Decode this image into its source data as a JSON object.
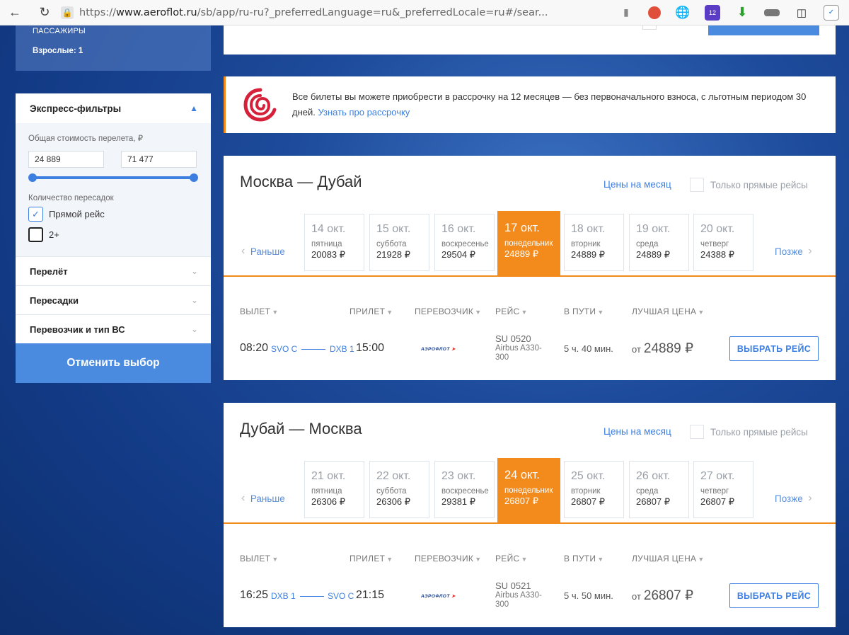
{
  "browser": {
    "url_prefix": "https://",
    "url_domain": "www.aeroflot.ru",
    "url_path": "/sb/app/ru-ru?_preferredLanguage=ru&_preferredLocale=ru#/sear...",
    "ext_badge": "12"
  },
  "sidebar": {
    "passengers_title": "ПАССАЖИРЫ",
    "passengers_value": "Взрослые: 1",
    "express_title": "Экспресс-фильтры",
    "price_label": "Общая стоимость перелета, ₽",
    "price_min": "24 889",
    "price_max": "71 477",
    "price_range_fraction": [
      0,
      1
    ],
    "transfers_label": "Количество пересадок",
    "opt_direct": "Прямой рейс",
    "opt_two_plus": "2+",
    "sec_flight": "Перелёт",
    "sec_transfers": "Пересадки",
    "sec_carrier": "Перевозчик и тип ВС",
    "cancel": "Отменить выбор"
  },
  "promo": {
    "text": "Все билеты вы можете приобрести в рассрочку на 12 месяцев — без первоначального взноса, с льготным периодом 30 дней.",
    "link": "Узнать про рассрочку"
  },
  "common": {
    "month_prices": "Цены на месяц",
    "direct_only": "Только прямые рейсы",
    "earlier": "Раньше",
    "later": "Позже",
    "col_departure": "ВЫЛЕТ",
    "col_arrival": "ПРИЛЕТ",
    "col_carrier": "ПЕРЕВОЗЧИК",
    "col_flight": "РЕЙС",
    "col_duration": "В ПУТИ",
    "col_best_price": "ЛУЧШАЯ ЦЕНА",
    "select": "ВЫБРАТЬ РЕЙС",
    "from": "от",
    "carrier_logo": "АЭРОФЛОТ"
  },
  "outbound": {
    "title": "Москва — Дубай",
    "dates": [
      {
        "d": "14 окт.",
        "w": "пятница",
        "p": "20083 ₽"
      },
      {
        "d": "15 окт.",
        "w": "суббота",
        "p": "21928 ₽"
      },
      {
        "d": "16 окт.",
        "w": "воскресенье",
        "p": "29504 ₽"
      },
      {
        "d": "17 окт.",
        "w": "понедельник",
        "p": "24889 ₽"
      },
      {
        "d": "18 окт.",
        "w": "вторник",
        "p": "24889 ₽"
      },
      {
        "d": "19 окт.",
        "w": "среда",
        "p": "24889 ₽"
      },
      {
        "d": "20 окт.",
        "w": "четверг",
        "p": "24388 ₽"
      }
    ],
    "flight": {
      "dep_time": "08:20",
      "dep_airport": "SVO C",
      "arr_airport": "DXB 1",
      "arr_time": "15:00",
      "number": "SU 0520",
      "aircraft": "Airbus A330-300",
      "duration": "5 ч. 40 мин.",
      "price": "24889 ₽"
    }
  },
  "inbound": {
    "title": "Дубай — Москва",
    "dates": [
      {
        "d": "21 окт.",
        "w": "пятница",
        "p": "26306 ₽"
      },
      {
        "d": "22 окт.",
        "w": "суббота",
        "p": "26306 ₽"
      },
      {
        "d": "23 окт.",
        "w": "воскресенье",
        "p": "29381 ₽"
      },
      {
        "d": "24 окт.",
        "w": "понедельник",
        "p": "26807 ₽"
      },
      {
        "d": "25 окт.",
        "w": "вторник",
        "p": "26807 ₽"
      },
      {
        "d": "26 окт.",
        "w": "среда",
        "p": "26807 ₽"
      },
      {
        "d": "27 окт.",
        "w": "четверг",
        "p": "26807 ₽"
      }
    ],
    "flight": {
      "dep_time": "16:25",
      "dep_airport": "DXB 1",
      "arr_airport": "SVO C",
      "arr_time": "21:15",
      "number": "SU 0521",
      "aircraft": "Airbus A330-300",
      "duration": "5 ч. 50 мин.",
      "price": "26807 ₽"
    }
  }
}
